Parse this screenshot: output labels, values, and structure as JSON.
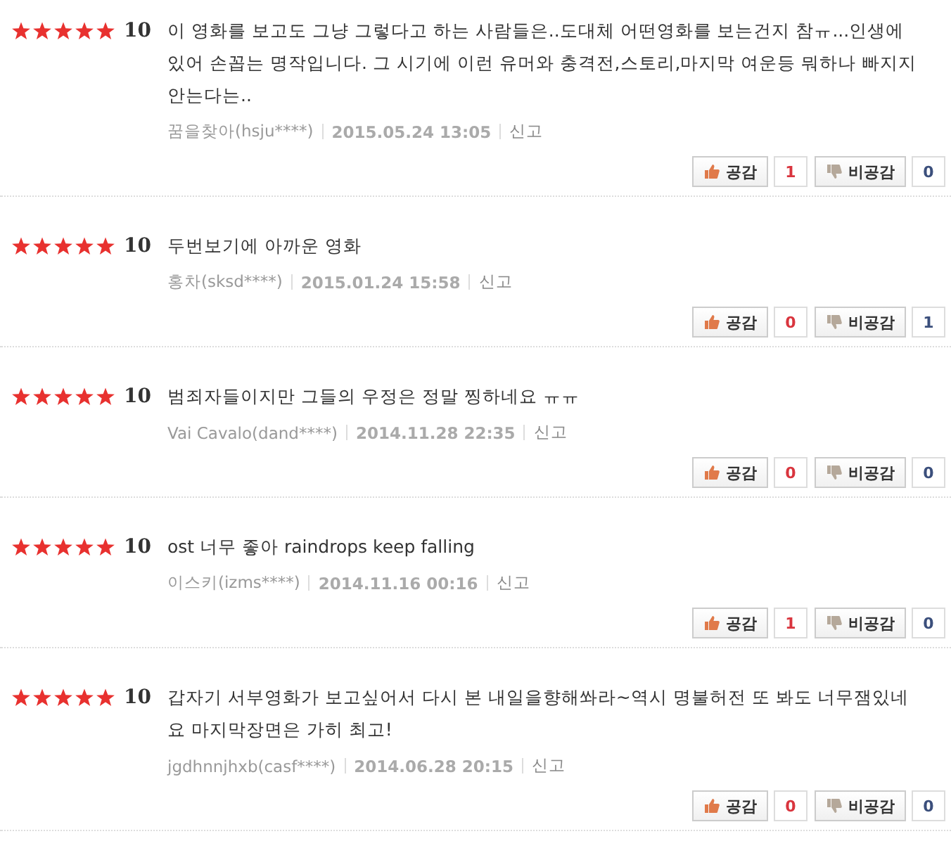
{
  "reviews": [
    {
      "stars": 5,
      "score": "10",
      "text": "이 영화를 보고도 그냥 그렇다고 하는 사람들은..도대체 어떤영화를 보는건지 참ㅠ...인생에 있어 손꼽는 명작입니다. 그 시기에 이런 유머와 충격전,스토리,마지막 여운등 뭐하나 빠지지 안는다는..",
      "author": "꿈을찾아(hsju****)",
      "date": "2015.05.24 13:05",
      "report": "신고",
      "like_label": "공감",
      "likes": "1",
      "dislike_label": "비공감",
      "dislikes": "0"
    },
    {
      "stars": 5,
      "score": "10",
      "text": "두번보기에 아까운 영화",
      "author": "홍차(sksd****)",
      "date": "2015.01.24 15:58",
      "report": "신고",
      "like_label": "공감",
      "likes": "0",
      "dislike_label": "비공감",
      "dislikes": "1"
    },
    {
      "stars": 5,
      "score": "10",
      "text": "범죄자들이지만 그들의 우정은 정말 찡하네요 ㅠㅠ",
      "author": "Vai Cavalo(dand****)",
      "date": "2014.11.28 22:35",
      "report": "신고",
      "like_label": "공감",
      "likes": "0",
      "dislike_label": "비공감",
      "dislikes": "0"
    },
    {
      "stars": 5,
      "score": "10",
      "text": "ost 너무 좋아 raindrops keep falling",
      "author": "이스키(izms****)",
      "date": "2014.11.16 00:16",
      "report": "신고",
      "like_label": "공감",
      "likes": "1",
      "dislike_label": "비공감",
      "dislikes": "0"
    },
    {
      "stars": 5,
      "score": "10",
      "text": "갑자기 서부영화가 보고싶어서 다시 본 내일을향해쏴라~역시 명불허전 또 봐도 너무잼있네요 마지막장면은 가히 최고!",
      "author": "jgdhnnjhxb(casf****)",
      "date": "2014.06.28 20:15",
      "report": "신고",
      "like_label": "공감",
      "likes": "0",
      "dislike_label": "비공감",
      "dislikes": "0"
    }
  ]
}
